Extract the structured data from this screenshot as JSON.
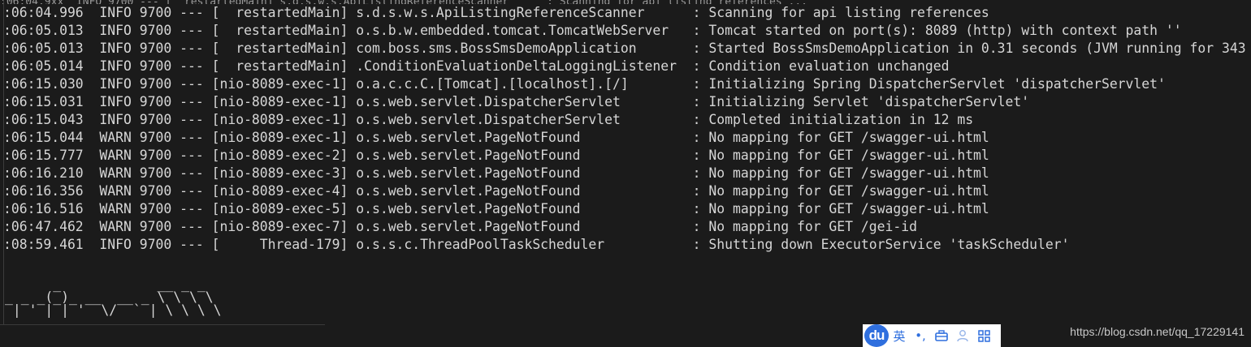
{
  "console": {
    "partial_top_line": ":06:04.9xx  INFO 9700 --- [  restartedMain] s.d.s.w.s.ApiListingReferenceScanner      : Scanning for api listing references ...",
    "lines": [
      {
        "time": ":06:04.996",
        "level": "INFO",
        "pid": "9700",
        "sep": "---",
        "thread": "[  restartedMain]",
        "logger": "s.d.s.w.s.ApiListingReferenceScanner",
        "message": ": Scanning for api listing references"
      },
      {
        "time": ":06:05.013",
        "level": "INFO",
        "pid": "9700",
        "sep": "---",
        "thread": "[  restartedMain]",
        "logger": "o.s.b.w.embedded.tomcat.TomcatWebServer",
        "message": ": Tomcat started on port(s): 8089 (http) with context path ''"
      },
      {
        "time": ":06:05.013",
        "level": "INFO",
        "pid": "9700",
        "sep": "---",
        "thread": "[  restartedMain]",
        "logger": "com.boss.sms.BossSmsDemoApplication",
        "message": ": Started BossSmsDemoApplication in 0.31 seconds (JVM running for 343"
      },
      {
        "time": ":06:05.014",
        "level": "INFO",
        "pid": "9700",
        "sep": "---",
        "thread": "[  restartedMain]",
        "logger": ".ConditionEvaluationDeltaLoggingListener",
        "message": ": Condition evaluation unchanged"
      },
      {
        "time": ":06:15.030",
        "level": "INFO",
        "pid": "9700",
        "sep": "---",
        "thread": "[nio-8089-exec-1]",
        "logger": "o.a.c.c.C.[Tomcat].[localhost].[/]",
        "message": ": Initializing Spring DispatcherServlet 'dispatcherServlet'"
      },
      {
        "time": ":06:15.031",
        "level": "INFO",
        "pid": "9700",
        "sep": "---",
        "thread": "[nio-8089-exec-1]",
        "logger": "o.s.web.servlet.DispatcherServlet",
        "message": ": Initializing Servlet 'dispatcherServlet'"
      },
      {
        "time": ":06:15.043",
        "level": "INFO",
        "pid": "9700",
        "sep": "---",
        "thread": "[nio-8089-exec-1]",
        "logger": "o.s.web.servlet.DispatcherServlet",
        "message": ": Completed initialization in 12 ms"
      },
      {
        "time": ":06:15.044",
        "level": "WARN",
        "pid": "9700",
        "sep": "---",
        "thread": "[nio-8089-exec-1]",
        "logger": "o.s.web.servlet.PageNotFound",
        "message": ": No mapping for GET /swagger-ui.html"
      },
      {
        "time": ":06:15.777",
        "level": "WARN",
        "pid": "9700",
        "sep": "---",
        "thread": "[nio-8089-exec-2]",
        "logger": "o.s.web.servlet.PageNotFound",
        "message": ": No mapping for GET /swagger-ui.html"
      },
      {
        "time": ":06:16.210",
        "level": "WARN",
        "pid": "9700",
        "sep": "---",
        "thread": "[nio-8089-exec-3]",
        "logger": "o.s.web.servlet.PageNotFound",
        "message": ": No mapping for GET /swagger-ui.html"
      },
      {
        "time": ":06:16.356",
        "level": "WARN",
        "pid": "9700",
        "sep": "---",
        "thread": "[nio-8089-exec-4]",
        "logger": "o.s.web.servlet.PageNotFound",
        "message": ": No mapping for GET /swagger-ui.html"
      },
      {
        "time": ":06:16.516",
        "level": "WARN",
        "pid": "9700",
        "sep": "---",
        "thread": "[nio-8089-exec-5]",
        "logger": "o.s.web.servlet.PageNotFound",
        "message": ": No mapping for GET /swagger-ui.html"
      },
      {
        "time": ":06:47.462",
        "level": "WARN",
        "pid": "9700",
        "sep": "---",
        "thread": "[nio-8089-exec-7]",
        "logger": "o.s.web.servlet.PageNotFound",
        "message": ": No mapping for GET /gei-id"
      },
      {
        "time": ":08:59.461",
        "level": "INFO",
        "pid": "9700",
        "sep": "---",
        "thread": "[     Thread-179]",
        "logger": "o.s.s.c.ThreadPoolTaskScheduler",
        "message": ": Shutting down ExecutorService 'taskScheduler'"
      }
    ],
    "banner": "      _            __ _ _\n_ _ _(_)_ __  __ _ \\ \\ \\ \\\n | ' | | '  \\/  ` | \\ \\ \\ \\"
  },
  "ime": {
    "logo_text": "du",
    "lang_label": "英",
    "punct_label": "•,",
    "icons": [
      "toolbox-icon",
      "user-icon",
      "grid-icon"
    ]
  },
  "watermark": "https://blog.csdn.net/qq_17229141",
  "colors": {
    "background": "#1b1b1b",
    "text": "#d6d6d6",
    "ime_blue": "#2f6fde"
  }
}
